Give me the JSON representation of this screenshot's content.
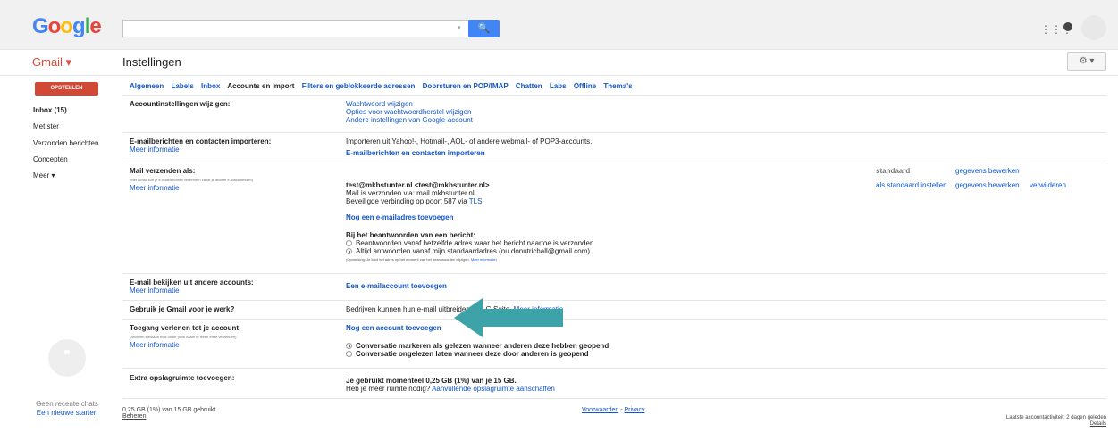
{
  "header": {
    "logo_letters": [
      {
        "ch": "G",
        "color": "#4285f4"
      },
      {
        "ch": "o",
        "color": "#ea4335"
      },
      {
        "ch": "o",
        "color": "#fbbc05"
      },
      {
        "ch": "g",
        "color": "#4285f4"
      },
      {
        "ch": "l",
        "color": "#34a853"
      },
      {
        "ch": "e",
        "color": "#ea4335"
      }
    ],
    "search_value": "",
    "search_dropdown": "▾",
    "search_icon": "🔍",
    "apps_icon": "⋮⋮⋮",
    "gmail_label": "Gmail ▾",
    "page_title": "Instellingen",
    "gear_label": "⚙ ▾"
  },
  "nav": {
    "compose": "OPSTELLEN",
    "items": [
      "Inbox (15)",
      "Met ster",
      "Verzonden berichten",
      "Concepten",
      "Meer ▾"
    ],
    "hangouts_glyph": "❞",
    "no_chats": "Geen recente chats",
    "new_chat": "Een nieuwe starten"
  },
  "tabs": [
    "Algemeen",
    "Labels",
    "Inbox",
    "Accounts en import",
    "Filters en geblokkeerde adressen",
    "Doorsturen en POP/IMAP",
    "Chatten",
    "Labs",
    "Offline",
    "Thema's"
  ],
  "rows": {
    "account": {
      "label": "Accountinstellingen wijzigen:",
      "links": [
        "Wachtwoord wijzigen",
        "Opties voor wachtwoordherstel wijzigen",
        "Andere instellingen van Google-account"
      ]
    },
    "import": {
      "label": "E-mailberichten en contacten importeren:",
      "more": "Meer informatie",
      "text": "Importeren uit Yahoo!-, Hotmail-, AOL- of andere webmail- of POP3-accounts.",
      "link": "E-mailberichten en contacten importeren"
    },
    "send": {
      "label": "Mail verzenden als:",
      "small": "(Met Gmail kun je e-mailberichten verzenden vanaf je andere e-mailadressen)",
      "more": "Meer informatie",
      "address": "test@mkbstunter.nl <test@mkbstunter.nl>",
      "via": "Mail is verzonden via: mail.mkbstunter.nl",
      "secure": "Beveiligde verbinding op poort 587 via ",
      "tls": "TLS",
      "add": "Nog een e-mailadres toevoegen",
      "reply_title": "Bij het beantwoorden van een bericht:",
      "reply_opt1": "Beantwoorden vanaf hetzelfde adres waar het bericht naartoe is verzonden",
      "reply_opt2": "Altijd antwoorden vanaf mijn standaardadres (nu donutrichall@gmail.com)",
      "note": "(Opmerking: Je kunt het adres op het moment van het beantwoorden wijzigen. ",
      "note_link": "Meer informatie",
      "note_end": ")",
      "standaard": "standaard",
      "edit1": "gegevens bewerken",
      "set_default": "als standaard instellen",
      "edit2": "gegevens bewerken",
      "remove": "verwijderen"
    },
    "check": {
      "label": "E-mail bekijken uit andere accounts:",
      "more": "Meer informatie",
      "link": "Een e-mailaccount toevoegen"
    },
    "business": {
      "label": "Gebruik je Gmail voor je werk?",
      "text": "Bedrijven kunnen hun e-mail uitbreiden met G Suite. ",
      "link": "Meer informatie"
    },
    "grant": {
      "label": "Toegang verlenen tot je account:",
      "small": "(Anderen toestaan mail onder jouw naam te lezen en te verzenden)",
      "more": "Meer informatie",
      "link": "Nog een account toevoegen",
      "opt1": "Conversatie markeren als gelezen wanneer anderen deze hebben geopend",
      "opt2": "Conversatie ongelezen laten wanneer deze door anderen is geopend"
    },
    "storage": {
      "label": "Extra opslagruimte toevoegen:",
      "usage": "Je gebruikt momenteel 0,25 GB (1%) van je 15 GB.",
      "more_q": "Heb je meer ruimte nodig? ",
      "buy": "Aanvullende opslagruimte aanschaffen"
    }
  },
  "footer": {
    "usage": "0,25 GB (1%) van 15 GB gebruikt",
    "manage": "Beheren",
    "terms": "Voorwaarden",
    "sep": " - ",
    "privacy": "Privacy",
    "activity": "Laatste accountactiviteit: 2 dagen geleden",
    "details": "Details"
  },
  "colors": {
    "accent": "#15c",
    "compose": "#d14836",
    "arrow": "#3ea3a8"
  }
}
